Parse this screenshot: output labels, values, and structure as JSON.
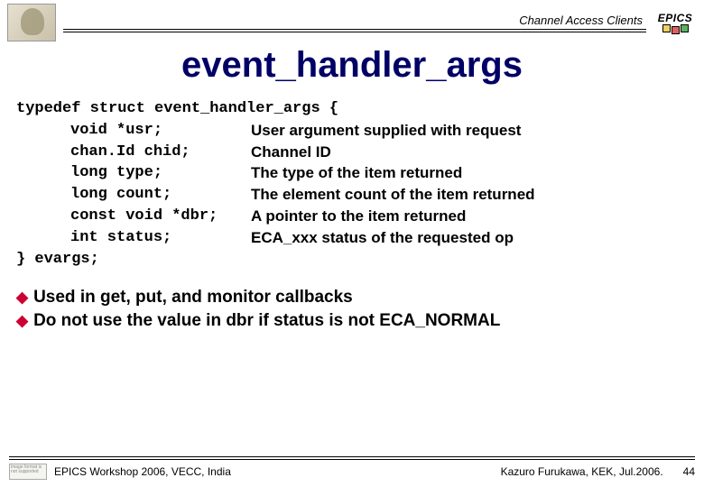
{
  "header": {
    "caption": "Channel Access Clients",
    "brand": "EPICS"
  },
  "title": "event_handler_args",
  "code": {
    "open_line": "typedef struct event_handler_args {",
    "fields": [
      {
        "decl": "void *usr;",
        "desc": "User argument supplied with request"
      },
      {
        "decl": "chan.Id chid;",
        "desc": "Channel ID"
      },
      {
        "decl": "long type;",
        "desc": "The type of the item returned"
      },
      {
        "decl": "long count;",
        "desc": "The element count of the item returned"
      },
      {
        "decl": "const void *dbr;",
        "desc": "A pointer to the item returned"
      },
      {
        "decl": "int status;",
        "desc": "ECA_xxx status of the requested op"
      }
    ],
    "close_line": "} evargs;"
  },
  "bullets": [
    "Used in get, put, and monitor callbacks",
    "Do not use the value in dbr if status is not ECA_NORMAL"
  ],
  "footer": {
    "left": "EPICS Workshop 2006, VECC, India",
    "right": "Kazuro Furukawa, KEK, Jul.2006.",
    "page": "44",
    "thumb_text": "image format is not supported"
  }
}
